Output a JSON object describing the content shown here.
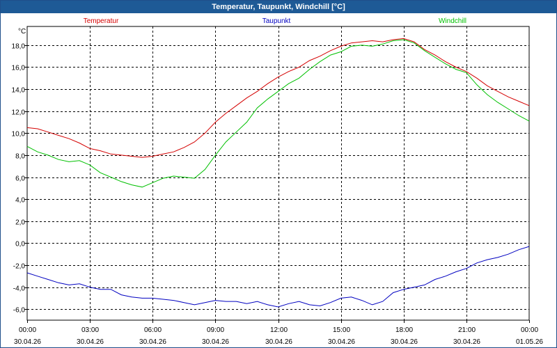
{
  "window": {
    "title": "Temperatur, Taupunkt, Windchill [°C]"
  },
  "chart_data": {
    "type": "line",
    "title": "Temperatur, Taupunkt, Windchill [°C]",
    "ylabel": "°C",
    "ylim": [
      -7.0,
      19.7
    ],
    "y_ticks": [
      "-6,0",
      "-4,0",
      "-2,0",
      "0,0",
      "2,0",
      "4,0",
      "6,0",
      "8,0",
      "10,0",
      "12,0",
      "14,0",
      "16,0",
      "18,0"
    ],
    "y_tick_values": [
      -6,
      -4,
      -2,
      0,
      2,
      4,
      6,
      8,
      10,
      12,
      14,
      16,
      18
    ],
    "xlim_hours": [
      0,
      24
    ],
    "x_ticks": [
      {
        "time": "00:00",
        "date": "30.04.26",
        "hour": 0
      },
      {
        "time": "03:00",
        "date": "30.04.26",
        "hour": 3
      },
      {
        "time": "06:00",
        "date": "30.04.26",
        "hour": 6
      },
      {
        "time": "09:00",
        "date": "30.04.26",
        "hour": 9
      },
      {
        "time": "12:00",
        "date": "30.04.26",
        "hour": 12
      },
      {
        "time": "15:00",
        "date": "30.04.26",
        "hour": 15
      },
      {
        "time": "18:00",
        "date": "30.04.26",
        "hour": 18
      },
      {
        "time": "21:00",
        "date": "30.04.26",
        "hour": 21
      },
      {
        "time": "00:00",
        "date": "01.05.26",
        "hour": 24
      }
    ],
    "grid": true,
    "legend_position": "top",
    "series": [
      {
        "name": "Temperatur",
        "color": "#d40000",
        "points": [
          [
            0,
            10.5
          ],
          [
            0.5,
            10.4
          ],
          [
            1,
            10.1
          ],
          [
            1.5,
            9.8
          ],
          [
            2,
            9.5
          ],
          [
            2.5,
            9.1
          ],
          [
            3,
            8.6
          ],
          [
            3.5,
            8.4
          ],
          [
            4,
            8.1
          ],
          [
            4.5,
            8.0
          ],
          [
            5,
            7.9
          ],
          [
            5.5,
            7.8
          ],
          [
            6,
            7.9
          ],
          [
            6.5,
            8.1
          ],
          [
            7,
            8.3
          ],
          [
            7.5,
            8.7
          ],
          [
            8,
            9.2
          ],
          [
            8.5,
            10.0
          ],
          [
            9,
            11.0
          ],
          [
            9.5,
            11.8
          ],
          [
            10,
            12.5
          ],
          [
            10.5,
            13.2
          ],
          [
            11,
            13.8
          ],
          [
            11.5,
            14.5
          ],
          [
            12,
            15.1
          ],
          [
            12.5,
            15.6
          ],
          [
            13,
            16.0
          ],
          [
            13.5,
            16.6
          ],
          [
            14,
            17.0
          ],
          [
            14.5,
            17.5
          ],
          [
            15,
            17.9
          ],
          [
            15.5,
            18.2
          ],
          [
            16,
            18.3
          ],
          [
            16.5,
            18.4
          ],
          [
            17,
            18.3
          ],
          [
            17.5,
            18.5
          ],
          [
            18,
            18.6
          ],
          [
            18.5,
            18.3
          ],
          [
            19,
            17.6
          ],
          [
            19.5,
            17.1
          ],
          [
            20,
            16.5
          ],
          [
            20.5,
            16.0
          ],
          [
            21,
            15.6
          ],
          [
            21.5,
            15.0
          ],
          [
            22,
            14.3
          ],
          [
            22.5,
            13.8
          ],
          [
            23,
            13.3
          ],
          [
            23.5,
            12.9
          ],
          [
            24,
            12.5
          ]
        ]
      },
      {
        "name": "Taupunkt",
        "color": "#0000c0",
        "points": [
          [
            0,
            -2.7
          ],
          [
            0.5,
            -3.0
          ],
          [
            1,
            -3.3
          ],
          [
            1.5,
            -3.6
          ],
          [
            2,
            -3.8
          ],
          [
            2.5,
            -3.7
          ],
          [
            3,
            -4.0
          ],
          [
            3.5,
            -4.2
          ],
          [
            4,
            -4.2
          ],
          [
            4.5,
            -4.7
          ],
          [
            5,
            -4.9
          ],
          [
            5.5,
            -5.0
          ],
          [
            6,
            -5.0
          ],
          [
            6.5,
            -5.1
          ],
          [
            7,
            -5.2
          ],
          [
            7.5,
            -5.4
          ],
          [
            8,
            -5.6
          ],
          [
            8.5,
            -5.4
          ],
          [
            9,
            -5.2
          ],
          [
            9.5,
            -5.3
          ],
          [
            10,
            -5.3
          ],
          [
            10.5,
            -5.5
          ],
          [
            11,
            -5.3
          ],
          [
            11.5,
            -5.6
          ],
          [
            12,
            -5.8
          ],
          [
            12.5,
            -5.5
          ],
          [
            13,
            -5.3
          ],
          [
            13.5,
            -5.6
          ],
          [
            14,
            -5.7
          ],
          [
            14.5,
            -5.4
          ],
          [
            15,
            -5.0
          ],
          [
            15.5,
            -4.9
          ],
          [
            16,
            -5.2
          ],
          [
            16.5,
            -5.6
          ],
          [
            17,
            -5.3
          ],
          [
            17.5,
            -4.5
          ],
          [
            18,
            -4.2
          ],
          [
            18.5,
            -4.0
          ],
          [
            19,
            -3.8
          ],
          [
            19.5,
            -3.3
          ],
          [
            20,
            -3.0
          ],
          [
            20.5,
            -2.6
          ],
          [
            21,
            -2.3
          ],
          [
            21.5,
            -1.8
          ],
          [
            22,
            -1.5
          ],
          [
            22.5,
            -1.3
          ],
          [
            23,
            -1.0
          ],
          [
            23.5,
            -0.6
          ],
          [
            24,
            -0.3
          ]
        ]
      },
      {
        "name": "Windchill",
        "color": "#00c000",
        "points": [
          [
            0,
            8.8
          ],
          [
            0.5,
            8.3
          ],
          [
            1,
            8.0
          ],
          [
            1.5,
            7.6
          ],
          [
            2,
            7.4
          ],
          [
            2.5,
            7.5
          ],
          [
            3,
            7.1
          ],
          [
            3.5,
            6.4
          ],
          [
            4,
            6.0
          ],
          [
            4.5,
            5.6
          ],
          [
            5,
            5.3
          ],
          [
            5.5,
            5.1
          ],
          [
            6,
            5.5
          ],
          [
            6.5,
            5.9
          ],
          [
            7,
            6.1
          ],
          [
            7.5,
            6.0
          ],
          [
            8,
            5.9
          ],
          [
            8.5,
            6.7
          ],
          [
            9,
            8.0
          ],
          [
            9.5,
            9.2
          ],
          [
            10,
            10.1
          ],
          [
            10.5,
            11.0
          ],
          [
            11,
            12.3
          ],
          [
            11.5,
            13.1
          ],
          [
            12,
            13.8
          ],
          [
            12.5,
            14.5
          ],
          [
            13,
            15.0
          ],
          [
            13.5,
            15.8
          ],
          [
            14,
            16.5
          ],
          [
            14.5,
            17.1
          ],
          [
            15,
            17.4
          ],
          [
            15.5,
            17.9
          ],
          [
            16,
            18.0
          ],
          [
            16.5,
            17.9
          ],
          [
            17,
            18.1
          ],
          [
            17.5,
            18.4
          ],
          [
            18,
            18.5
          ],
          [
            18.5,
            18.2
          ],
          [
            19,
            17.5
          ],
          [
            19.5,
            16.9
          ],
          [
            20,
            16.3
          ],
          [
            20.5,
            15.8
          ],
          [
            21,
            15.5
          ],
          [
            21.5,
            14.4
          ],
          [
            22,
            13.5
          ],
          [
            22.5,
            12.8
          ],
          [
            23,
            12.2
          ],
          [
            23.5,
            11.6
          ],
          [
            24,
            11.1
          ]
        ]
      }
    ]
  }
}
